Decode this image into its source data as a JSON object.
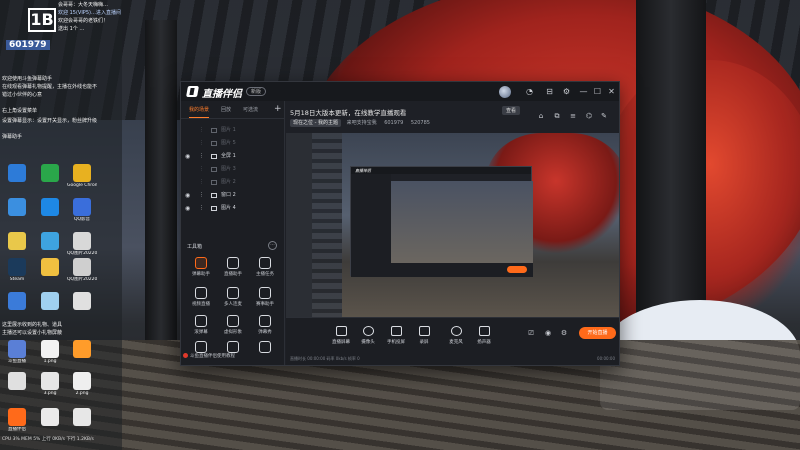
{
  "desktop": {
    "chat_lines": [
      {
        "text": "会哥哥：大冬天嗨嗨…",
        "style": "white"
      },
      {
        "text": "欢迎 15(VIP5)…进入直播间",
        "style": "blue"
      },
      {
        "text": "欢迎会哥哥的老铁们！",
        "style": "white"
      },
      {
        "text": "送出 1个 …",
        "style": "white"
      },
      {
        "text": "欢迎使用斗鱼弹幕助手",
        "style": "white"
      },
      {
        "text": "在线观看弹幕礼物提醒，主播在外线也能不",
        "style": "white"
      },
      {
        "text": "错过小伙伴的心意",
        "style": "white"
      },
      {
        "text": "右上角设置菜单",
        "style": "white"
      },
      {
        "text": "设置弹幕显示：设置开关显示，粉丝牌升级",
        "style": "white"
      },
      {
        "text": "弹幕助手",
        "style": "white"
      },
      {
        "text": "这里展示收到的礼物、道具",
        "style": "white"
      },
      {
        "text": "主播还可以设置小礼物屏蔽",
        "style": "white"
      }
    ],
    "logo_text": "1B",
    "room_number": "601979",
    "icons": [
      {
        "label": "",
        "color": "#2d7bd8"
      },
      {
        "label": "",
        "color": "#2aa74a"
      },
      {
        "label": "Google Chrome",
        "color": "#e8b120"
      },
      {
        "label": "",
        "color": "#3b8fe0"
      },
      {
        "label": "",
        "color": "#1e88e5"
      },
      {
        "label": "QQ影音",
        "color": "#3a6edb"
      },
      {
        "label": "",
        "color": "#e9c84a"
      },
      {
        "label": "",
        "color": "#3ea3e0"
      },
      {
        "label": "QQ图片2022011...",
        "color": "#d8d8d8"
      },
      {
        "label": "Steam",
        "color": "#1b3a5b"
      },
      {
        "label": "",
        "color": "#f0c040"
      },
      {
        "label": "QQ图片2022011...",
        "color": "#cfcfcf"
      },
      {
        "label": "",
        "color": "#3b7bd9"
      },
      {
        "label": "",
        "color": "#a0d0f0"
      },
      {
        "label": "",
        "color": "#e0e0e0"
      },
      {
        "label": "斗鱼直播",
        "color": "#5a7fd6"
      },
      {
        "label": "1.png",
        "color": "#f2f2f2"
      },
      {
        "label": "",
        "color": "#ff9c2a"
      },
      {
        "label": "",
        "color": "#e0e0e0"
      },
      {
        "label": "3.png",
        "color": "#e6e6e6"
      },
      {
        "label": "2.png",
        "color": "#efefef"
      },
      {
        "label": "直播伴侣",
        "color": "#ff6a1a"
      },
      {
        "label": "",
        "color": "#eaeaea"
      },
      {
        "label": "",
        "color": "#e7e7e7"
      }
    ],
    "sysinfo": "CPU 3% MEM 5% 上行 0KB/s 下行 1.2KB/s"
  },
  "app": {
    "title": "直播伴侣",
    "version_badge": "新版",
    "window_buttons": [
      "◔",
      "⊟",
      "⚙",
      "—",
      "☐",
      "✕"
    ],
    "left_tabs": [
      "我的场景",
      "回放",
      "可选流"
    ],
    "add_button": "+",
    "scenes": [
      {
        "name": "图片 1",
        "dim": true
      },
      {
        "name": "图片 5",
        "dim": true
      },
      {
        "name": "全屏 1",
        "dim": false
      },
      {
        "name": "图片 3",
        "dim": true
      },
      {
        "name": "图片 2",
        "dim": true
      },
      {
        "name": "窗口 2",
        "dim": false
      },
      {
        "name": "图片 4",
        "dim": false
      }
    ],
    "tools_heading": "工具箱",
    "tools_more": "···",
    "tools": [
      {
        "label": "弹幕助手",
        "orange": true
      },
      {
        "label": "直播助手",
        "orange": false
      },
      {
        "label": "主播任务",
        "orange": false
      },
      {
        "label": "视频直播",
        "orange": false
      },
      {
        "label": "多人连麦",
        "orange": false
      },
      {
        "label": "赛事助手",
        "orange": false
      },
      {
        "label": "滚弹幕",
        "orange": false
      },
      {
        "label": "虚拟形象",
        "orange": false
      },
      {
        "label": "弹幕秀",
        "orange": false
      },
      {
        "label": "",
        "orange": false
      },
      {
        "label": "",
        "orange": false
      },
      {
        "label": "",
        "orange": false
      }
    ],
    "notice": "斗鱼直播伴侣使用教程",
    "header_title": "5月18日大版本更新，在线教学直播观看",
    "header_view": "查看",
    "meta": {
      "tag": "现在之位 - 我的主题",
      "items": [
        "来吧支持宝我",
        "601979",
        "520785"
      ]
    },
    "header_icons": [
      "⌂",
      "⧉",
      "≡",
      "⌬",
      "✎"
    ],
    "preview_brand": "直播伴侣",
    "controls": [
      {
        "label": "直播屏幕",
        "round": false
      },
      {
        "label": "摄像头",
        "round": true
      },
      {
        "label": "手机投屏",
        "round": false
      },
      {
        "label": "录屏",
        "round": false
      },
      {
        "label": "麦克风",
        "round": true
      },
      {
        "label": "扬声器",
        "round": false
      }
    ],
    "small_controls": [
      "⎚",
      "◉",
      "⚙"
    ],
    "start_button": "开始直播",
    "stats_left": "直播时长 00:00:00  码率 0kb/s  帧率 0",
    "stats_right": "00:00:00"
  }
}
